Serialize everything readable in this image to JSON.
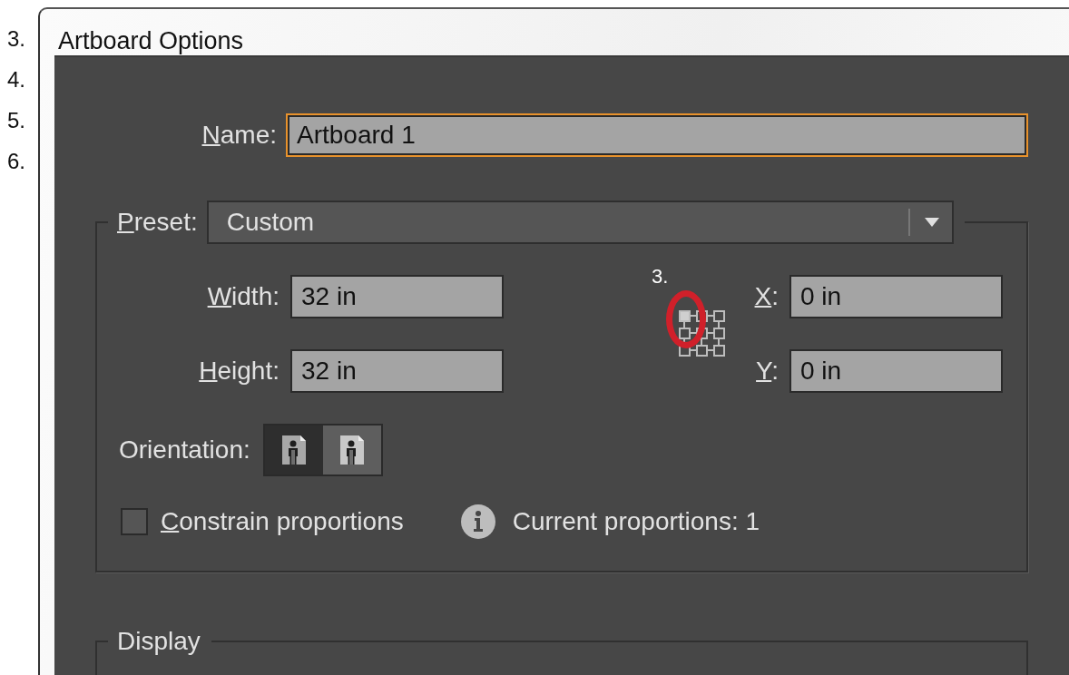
{
  "step_numbers": [
    "3.",
    "4.",
    "5.",
    "6."
  ],
  "window": {
    "title": "Artboard Options"
  },
  "name": {
    "label": "Name:",
    "mnemonic": true,
    "value": "Artboard 1",
    "focused": true
  },
  "preset": {
    "label": "Preset:",
    "mnemonic": true,
    "value": "Custom"
  },
  "size_fields": [
    {
      "label": "Width:",
      "mnemonic": true,
      "value": "32 in"
    },
    {
      "label": "Height:",
      "mnemonic": true,
      "value": "32 in"
    }
  ],
  "position_fields": [
    {
      "label": "X:",
      "mnemonic": true,
      "value": "0 in"
    },
    {
      "label": "Y:",
      "mnemonic": true,
      "value": "0 in"
    }
  ],
  "reference_points": [
    {
      "selected": true
    },
    {
      "selected": false
    },
    {
      "selected": false
    },
    {
      "selected": false
    },
    {
      "selected": false
    },
    {
      "selected": false
    },
    {
      "selected": false
    },
    {
      "selected": false
    },
    {
      "selected": false
    }
  ],
  "callout": {
    "label": "3."
  },
  "orientation": {
    "label": "Orientation:",
    "options": [
      {
        "selected": true
      },
      {
        "selected": false
      }
    ]
  },
  "constrain": {
    "label": "Constrain proportions",
    "mnemonic": true,
    "checked": false
  },
  "proportions_info": "Current proportions: 1",
  "display_section": {
    "label": "Display"
  }
}
